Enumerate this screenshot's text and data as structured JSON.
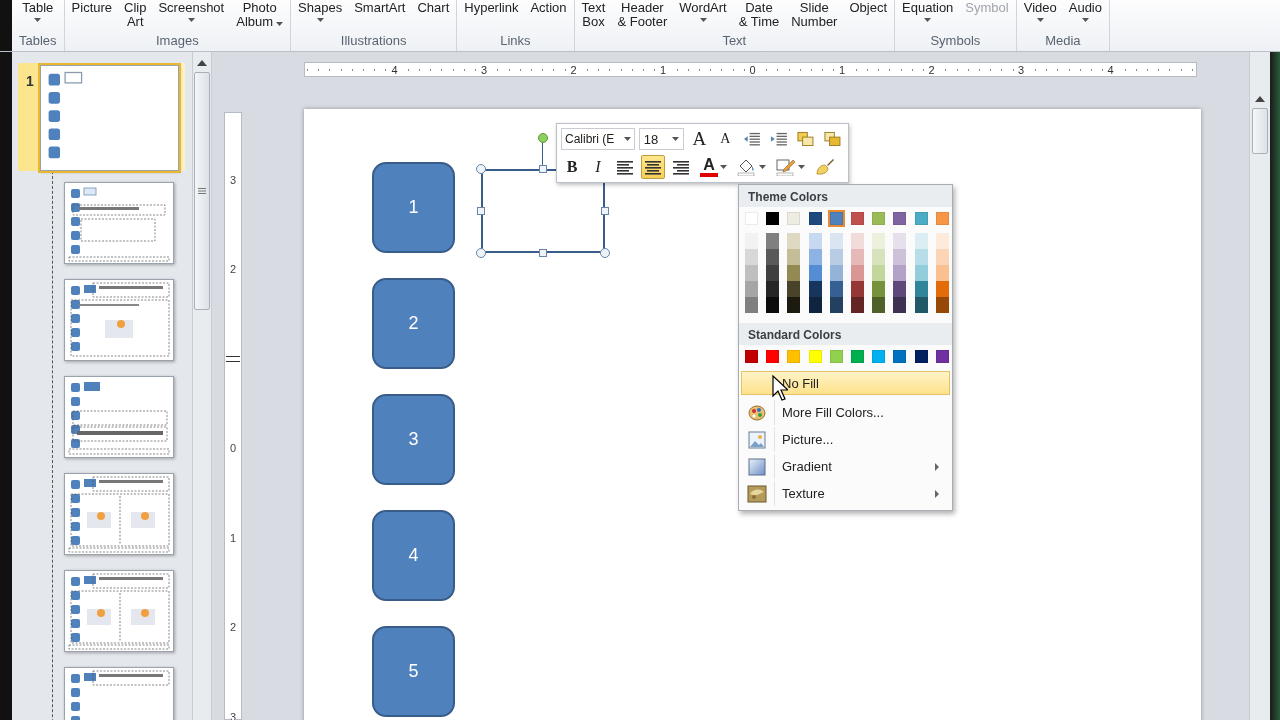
{
  "ribbon": {
    "groups": [
      {
        "label": "Tables",
        "commands": [
          {
            "lines": [
              "Table"
            ],
            "dropdown": true,
            "disabled": false
          }
        ]
      },
      {
        "label": "Images",
        "commands": [
          {
            "lines": [
              "Picture"
            ],
            "dropdown": false,
            "disabled": false
          },
          {
            "lines": [
              "Clip",
              "Art"
            ],
            "dropdown": false,
            "disabled": false
          },
          {
            "lines": [
              "Screenshot"
            ],
            "dropdown": true,
            "disabled": false
          },
          {
            "lines": [
              "Photo",
              "Album"
            ],
            "dropdown": true,
            "disabled": false
          }
        ]
      },
      {
        "label": "Illustrations",
        "commands": [
          {
            "lines": [
              "Shapes"
            ],
            "dropdown": true,
            "disabled": false
          },
          {
            "lines": [
              "SmartArt"
            ],
            "dropdown": false,
            "disabled": false
          },
          {
            "lines": [
              "Chart"
            ],
            "dropdown": false,
            "disabled": false
          }
        ]
      },
      {
        "label": "Links",
        "commands": [
          {
            "lines": [
              "Hyperlink"
            ],
            "dropdown": false,
            "disabled": false
          },
          {
            "lines": [
              "Action"
            ],
            "dropdown": false,
            "disabled": false
          }
        ]
      },
      {
        "label": "Text",
        "commands": [
          {
            "lines": [
              "Text",
              "Box"
            ],
            "dropdown": false,
            "disabled": false
          },
          {
            "lines": [
              "Header",
              "& Footer"
            ],
            "dropdown": false,
            "disabled": false
          },
          {
            "lines": [
              "WordArt"
            ],
            "dropdown": true,
            "disabled": false
          },
          {
            "lines": [
              "Date",
              "& Time"
            ],
            "dropdown": false,
            "disabled": false
          },
          {
            "lines": [
              "Slide",
              "Number"
            ],
            "dropdown": false,
            "disabled": false
          },
          {
            "lines": [
              "Object"
            ],
            "dropdown": false,
            "disabled": false
          }
        ]
      },
      {
        "label": "Symbols",
        "commands": [
          {
            "lines": [
              "Equation"
            ],
            "dropdown": true,
            "disabled": false
          },
          {
            "lines": [
              "Symbol"
            ],
            "dropdown": false,
            "disabled": true
          }
        ]
      },
      {
        "label": "Media",
        "commands": [
          {
            "lines": [
              "Video"
            ],
            "dropdown": true,
            "disabled": false
          },
          {
            "lines": [
              "Audio"
            ],
            "dropdown": true,
            "disabled": false
          }
        ]
      }
    ]
  },
  "slides": [
    {
      "number": "1",
      "selected": true,
      "kind": "boxes",
      "children": [
        {
          "kind": "title-body",
          "selected": false
        },
        {
          "kind": "title-picture",
          "selected": false
        },
        {
          "kind": "text",
          "selected": false
        },
        {
          "kind": "two-pictures",
          "selected": false
        },
        {
          "kind": "two-pictures",
          "selected": false
        },
        {
          "kind": "title-only",
          "selected": false
        }
      ]
    }
  ],
  "horizontal_ruler": [
    "4",
    "3",
    "2",
    "1",
    "0",
    "1",
    "2",
    "3",
    "4"
  ],
  "vertical_ruler": [
    {
      "kind": "number",
      "label": "3"
    },
    {
      "kind": "number",
      "label": "2"
    },
    {
      "kind": "indent-marker"
    },
    {
      "kind": "number",
      "label": "0"
    },
    {
      "kind": "number",
      "label": "1"
    },
    {
      "kind": "number",
      "label": "2"
    },
    {
      "kind": "number",
      "label": "3"
    }
  ],
  "slide": {
    "shapes": [
      {
        "label": "1"
      },
      {
        "label": "2"
      },
      {
        "label": "3"
      },
      {
        "label": "4"
      },
      {
        "label": "5"
      }
    ]
  },
  "mini_toolbar": {
    "font": "Calibri (E",
    "size": "18",
    "row1": [
      {
        "kind": "grow-font",
        "label": "A"
      },
      {
        "kind": "shrink-font",
        "label": "A"
      },
      {
        "kind": "decrease-indent"
      },
      {
        "kind": "increase-indent"
      },
      {
        "kind": "bring-forward"
      },
      {
        "kind": "send-backward"
      }
    ],
    "row2": [
      {
        "kind": "bold",
        "label": "B",
        "on": false
      },
      {
        "kind": "italic",
        "label": "I",
        "on": false
      },
      {
        "kind": "align-left",
        "selected": false
      },
      {
        "kind": "align-center",
        "selected": true
      },
      {
        "kind": "align-right",
        "selected": false
      },
      {
        "kind": "font-color",
        "label": "A"
      },
      {
        "kind": "fill-color"
      },
      {
        "kind": "outline"
      },
      {
        "kind": "format-painter"
      }
    ]
  },
  "fill_menu": {
    "theme_title": "Theme Colors",
    "theme_colors": [
      {
        "color": "#ffffff",
        "selected": false,
        "shades": [
          {
            "color": "#f2f2f2"
          },
          {
            "color": "#d8d8d8"
          },
          {
            "color": "#bfbfbf"
          },
          {
            "color": "#a5a5a5"
          },
          {
            "color": "#7f7f7f"
          }
        ]
      },
      {
        "color": "#000000",
        "selected": false,
        "shades": [
          {
            "color": "#7f7f7f"
          },
          {
            "color": "#595959"
          },
          {
            "color": "#3f3f3f"
          },
          {
            "color": "#262626"
          },
          {
            "color": "#0c0c0c"
          }
        ]
      },
      {
        "color": "#eeece1",
        "selected": false,
        "shades": [
          {
            "color": "#ddd9c3"
          },
          {
            "color": "#c4bd97"
          },
          {
            "color": "#938953"
          },
          {
            "color": "#494429"
          },
          {
            "color": "#1d1b10"
          }
        ]
      },
      {
        "color": "#1f497d",
        "selected": false,
        "shades": [
          {
            "color": "#c6d9f0"
          },
          {
            "color": "#8db3e2"
          },
          {
            "color": "#548dd4"
          },
          {
            "color": "#17365d"
          },
          {
            "color": "#0f243e"
          }
        ]
      },
      {
        "color": "#4f81bd",
        "selected": true,
        "shades": [
          {
            "color": "#dbe5f1"
          },
          {
            "color": "#b8cce4"
          },
          {
            "color": "#95b3d7"
          },
          {
            "color": "#366092"
          },
          {
            "color": "#244061"
          }
        ]
      },
      {
        "color": "#c0504d",
        "selected": false,
        "shades": [
          {
            "color": "#f2dcdb"
          },
          {
            "color": "#e5b9b7"
          },
          {
            "color": "#d99694"
          },
          {
            "color": "#953734"
          },
          {
            "color": "#632423"
          }
        ]
      },
      {
        "color": "#9bbb59",
        "selected": false,
        "shades": [
          {
            "color": "#ebf1dd"
          },
          {
            "color": "#d7e3bc"
          },
          {
            "color": "#c3d69b"
          },
          {
            "color": "#76923c"
          },
          {
            "color": "#4f6128"
          }
        ]
      },
      {
        "color": "#8064a2",
        "selected": false,
        "shades": [
          {
            "color": "#e5e0ec"
          },
          {
            "color": "#ccc1d9"
          },
          {
            "color": "#b2a2c7"
          },
          {
            "color": "#5f497a"
          },
          {
            "color": "#3f3151"
          }
        ]
      },
      {
        "color": "#4bacc6",
        "selected": false,
        "shades": [
          {
            "color": "#dbeef3"
          },
          {
            "color": "#b7dde8"
          },
          {
            "color": "#92cddc"
          },
          {
            "color": "#31859b"
          },
          {
            "color": "#205867"
          }
        ]
      },
      {
        "color": "#f79646",
        "selected": false,
        "shades": [
          {
            "color": "#fdeada"
          },
          {
            "color": "#fbd5b5"
          },
          {
            "color": "#fac08f"
          },
          {
            "color": "#e36c09"
          },
          {
            "color": "#974806"
          }
        ]
      }
    ],
    "standard_title": "Standard Colors",
    "standard_colors": [
      {
        "color": "#c00000"
      },
      {
        "color": "#ff0000"
      },
      {
        "color": "#ffc000"
      },
      {
        "color": "#ffff00"
      },
      {
        "color": "#92d050"
      },
      {
        "color": "#00b050"
      },
      {
        "color": "#00b0f0"
      },
      {
        "color": "#0070c0"
      },
      {
        "color": "#002060"
      },
      {
        "color": "#7030a0"
      }
    ],
    "items": [
      {
        "kind": "none",
        "label": "No Fill",
        "highlighted": true,
        "submenu": false
      },
      {
        "kind": "palette",
        "label": "More Fill Colors...",
        "highlighted": false,
        "submenu": false
      },
      {
        "kind": "picture",
        "label": "Picture...",
        "highlighted": false,
        "submenu": false
      },
      {
        "kind": "gradient",
        "label": "Gradient",
        "highlighted": false,
        "submenu": true
      },
      {
        "kind": "texture",
        "label": "Texture",
        "highlighted": false,
        "submenu": true
      }
    ]
  }
}
